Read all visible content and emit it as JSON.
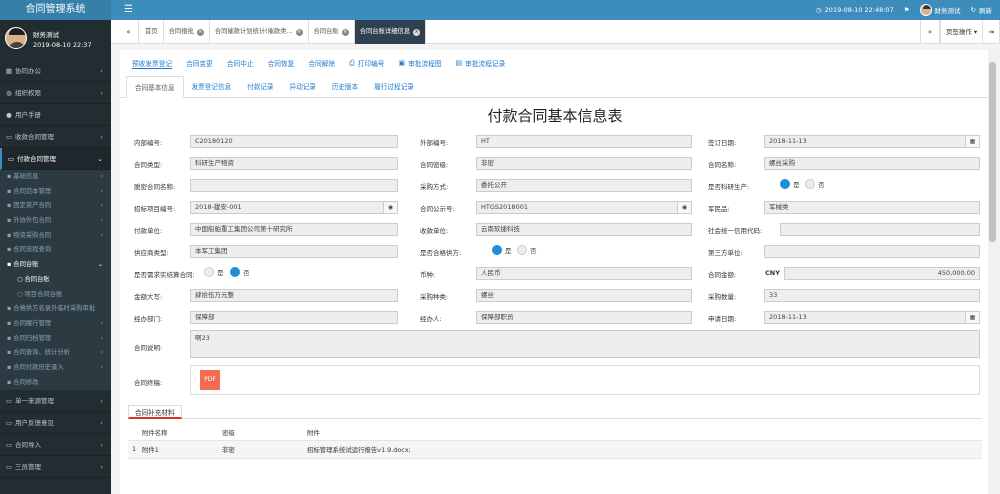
{
  "app": {
    "title": "合同管理系统"
  },
  "topbar": {
    "datetime": "2019-08-10 22:48:07",
    "user": "财务测试",
    "refresh": "刷新"
  },
  "sidebar": {
    "user_name": "财务测试",
    "user_date": "2019-08-10 22:37",
    "menu_top": [
      {
        "label": "协同办公",
        "icon": "grid-icon"
      },
      {
        "label": "组织权限",
        "icon": "people-icon"
      },
      {
        "label": "用户手册",
        "icon": "user-icon"
      },
      {
        "label": "收款合同管理",
        "icon": "folder-icon"
      },
      {
        "label": "付款合同管理",
        "icon": "folder-icon"
      }
    ],
    "submenu": [
      {
        "label": "基础信息"
      },
      {
        "label": "合同范本管理"
      },
      {
        "label": "固定资产合同"
      },
      {
        "label": "外协外包合同"
      },
      {
        "label": "物资采购合同"
      },
      {
        "label": "合同流程查询"
      },
      {
        "label": "合同台账"
      },
      {
        "label": "合同台账"
      },
      {
        "label": "项目合同台账"
      },
      {
        "label": "合格供方名录外临时采购审批"
      },
      {
        "label": "合同履行管理"
      },
      {
        "label": "合同归档管理"
      },
      {
        "label": "合同查询、统计分析"
      },
      {
        "label": "合同付款历史录入"
      },
      {
        "label": "合同修改"
      }
    ],
    "menu_bottom": [
      {
        "label": "单一来源管理"
      },
      {
        "label": "用户反馈意见"
      },
      {
        "label": "合同导入"
      },
      {
        "label": "三员管理"
      }
    ]
  },
  "tabbar": {
    "tabs": [
      {
        "label": "首页"
      },
      {
        "label": "合同报批"
      },
      {
        "label": "合同催款计划统计(催款类..."
      },
      {
        "label": "合同台账"
      },
      {
        "label": "合同台账详细信息"
      }
    ],
    "ops": "页签操作"
  },
  "actions": [
    {
      "label": "预收发票登记"
    },
    {
      "label": "合同变更"
    },
    {
      "label": "合同中止"
    },
    {
      "label": "合同恢复"
    },
    {
      "label": "合同解除"
    },
    {
      "label": "打印编号"
    },
    {
      "label": "审批流程图"
    },
    {
      "label": "审批流程记录"
    }
  ],
  "subtabs": [
    "合同基本信息",
    "发票登记信息",
    "付款记录",
    "异动记录",
    "历史版本",
    "履行过程记录"
  ],
  "form": {
    "title": "付款合同基本信息表",
    "internal_no_label": "内部编号:",
    "internal_no": "C20180120",
    "external_no_label": "外部编号:",
    "external_no": "HT",
    "sign_date_label": "签订日期:",
    "sign_date": "2018-11-13",
    "type_label": "合同类型:",
    "type": "科研生产物资",
    "secret_label": "合同密级:",
    "secret": "非密",
    "name_label": "合同名称:",
    "name": "螺丝采购",
    "desecret_label": "脱密合同名称:",
    "desecret": "",
    "purchase_method_label": "采购方式:",
    "purchase_method": "委托公开",
    "research_label": "是否科研生产:",
    "yes": "是",
    "no": "否",
    "bid_no_label": "招标项目编号:",
    "bid_no": "2018-建安-001",
    "publicity_label": "合同公示号:",
    "publicity": "HTGS2018001",
    "military_label": "军民品:",
    "military": "军械类",
    "payer_label": "付款单位:",
    "payer": "中国船舶重工集团公司第十研究所",
    "receiver_label": "收款单位:",
    "receiver": "云南软捷科技",
    "credit_label": "社会统一信用代码:",
    "credit": "",
    "supplier_type_label": "供应商类型:",
    "supplier_type": "本军工集团",
    "qualified_label": "是否合格供方:",
    "third_party_label": "第三方单位:",
    "third_party": "",
    "settle_label": "是否需求实结算合同:",
    "currency_label": "币种:",
    "currency": "人民币",
    "amount_label": "合同金额:",
    "amount_unit": "CNY",
    "amount": "450,000.00",
    "amount_cn_label": "金额大写:",
    "amount_cn": "肆拾伍万元整",
    "purchase_type_label": "采购种类:",
    "purchase_type": "螺丝",
    "quantity_label": "采购数量:",
    "quantity": "33",
    "dept_label": "经办部门:",
    "dept": "保障部",
    "handler_label": "经办人:",
    "handler": "保障部职员",
    "apply_date_label": "申请日期:",
    "apply_date": "2018-11-13",
    "desc_label": "合同说明:",
    "desc": "啊23",
    "attach_label": "合同终稿:",
    "attach_icon": "PDF"
  },
  "supplement": {
    "tab": "合同补充材料",
    "headers": [
      "附件名称",
      "密级",
      "附件"
    ],
    "rows": [
      {
        "no": "1",
        "name": "附件1",
        "level": "非密",
        "file": "招标管理系统试运行报告v1.9.docx;"
      }
    ]
  }
}
